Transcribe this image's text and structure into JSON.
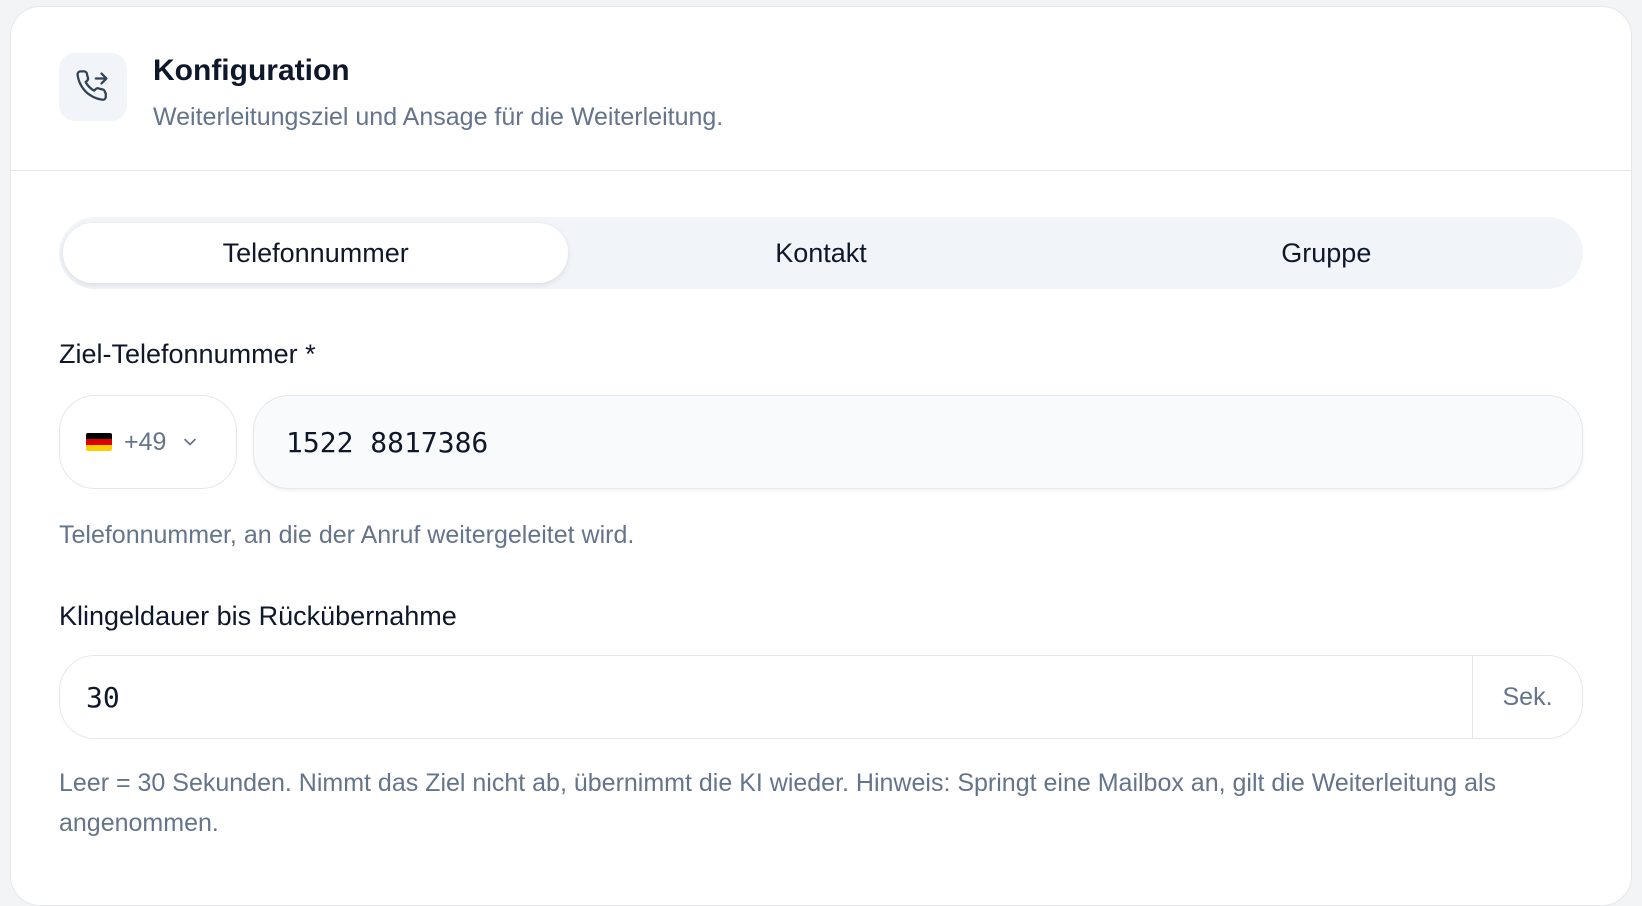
{
  "header": {
    "title": "Konfiguration",
    "subtitle": "Weiterleitungsziel und Ansage für die Weiterleitung.",
    "icon": "phone-forward-icon"
  },
  "tabs": [
    {
      "label": "Telefonnummer",
      "active": true
    },
    {
      "label": "Kontakt",
      "active": false
    },
    {
      "label": "Gruppe",
      "active": false
    }
  ],
  "phone": {
    "label": "Ziel-Telefonnummer *",
    "country_code": "+49",
    "country_flag": "germany-flag-icon",
    "value": "1522 8817386",
    "help": "Telefonnummer, an die der Anruf weitergeleitet wird."
  },
  "ring": {
    "label": "Klingeldauer bis Rückübernahme",
    "value": "30",
    "unit": "Sek.",
    "help": "Leer = 30 Sekunden. Nimmt das Ziel nicht ab, übernimmt die KI wieder. Hinweis: Springt eine Mailbox an, gilt die Weiterleitung als angenommen."
  },
  "colors": {
    "muted_text": "#64748b",
    "border": "#e5e7eb",
    "tab_bg": "#f1f5f9"
  }
}
